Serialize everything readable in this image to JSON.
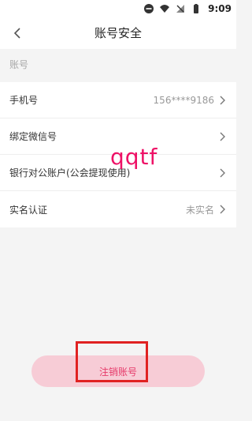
{
  "status_bar": {
    "time": "9:09",
    "icons": [
      "minus-circle-icon",
      "wifi-icon",
      "no-signal-icon",
      "battery-icon"
    ]
  },
  "header": {
    "title": "账号安全",
    "back_icon": "chevron-left-icon"
  },
  "section": {
    "label": "账号"
  },
  "rows": [
    {
      "label": "手机号",
      "value": "156****9186"
    },
    {
      "label": "绑定微信号",
      "value": ""
    },
    {
      "label": "银行对公账户(公会提现使用)",
      "value": ""
    },
    {
      "label": "实名认证",
      "value": "未实名"
    }
  ],
  "watermark": "qqtf",
  "logout_button": {
    "label": "注销账号"
  },
  "colors": {
    "accent": "#e63a6a",
    "button_bg": "#f7ccd6",
    "highlight_border": "#e02222",
    "watermark": "#ee1166"
  }
}
